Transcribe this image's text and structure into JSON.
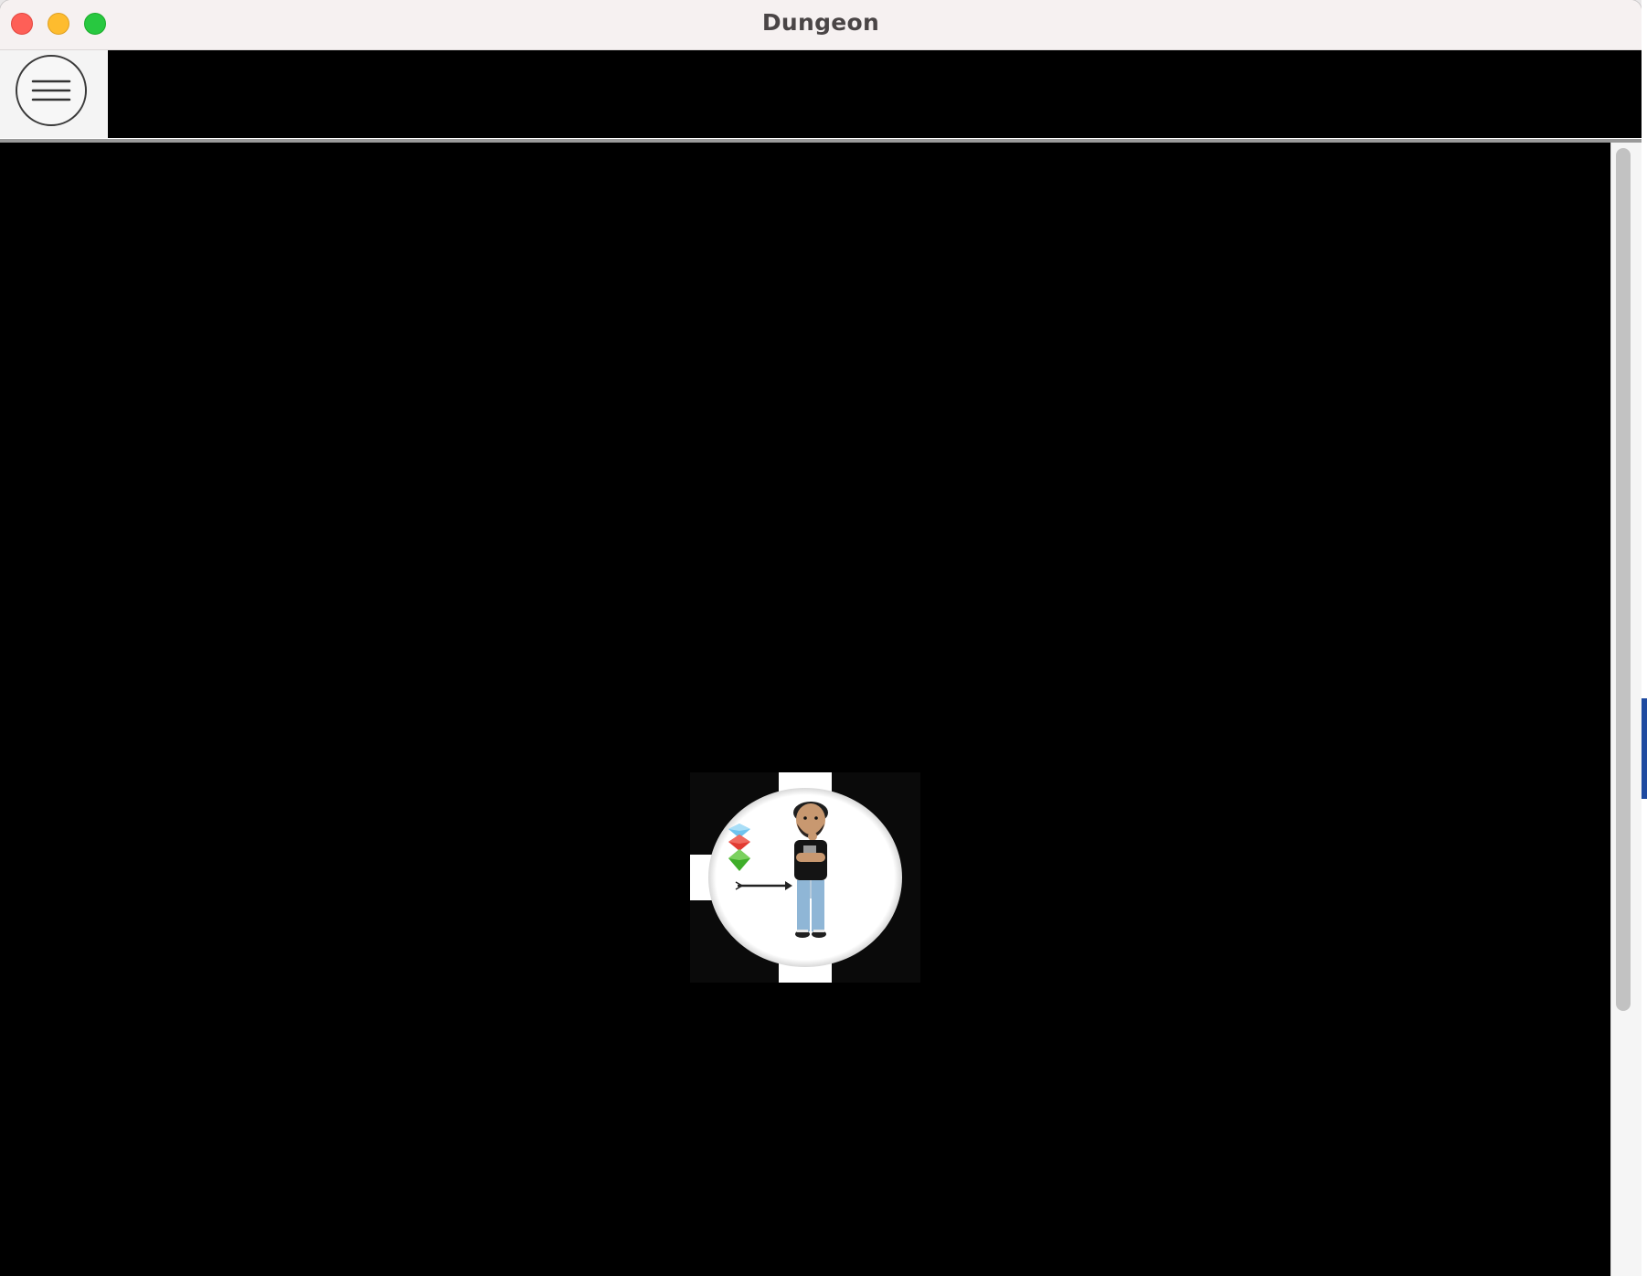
{
  "window": {
    "title": "Dungeon"
  },
  "titlebar": {
    "controls": [
      "close",
      "minimize",
      "maximize"
    ],
    "colors": {
      "close": "#fe5f57",
      "minimize": "#febc2e",
      "maximize": "#28c840"
    }
  },
  "toolbar": {
    "menu_icon": "hamburger-menu-icon"
  },
  "game": {
    "background": "#000000",
    "room": {
      "shape": "circle",
      "exits": [
        "north",
        "south",
        "west"
      ],
      "contents": [
        "player",
        "gems",
        "arrow"
      ]
    },
    "player": {
      "icon": "player-character-icon"
    },
    "items": [
      {
        "icon": "blue-gem-icon",
        "color": "#6fc3ee"
      },
      {
        "icon": "red-gem-icon",
        "color": "#e23b32"
      },
      {
        "icon": "green-gem-icon",
        "color": "#3fae2a"
      },
      {
        "icon": "arrow-icon",
        "color": "#222222"
      }
    ]
  }
}
